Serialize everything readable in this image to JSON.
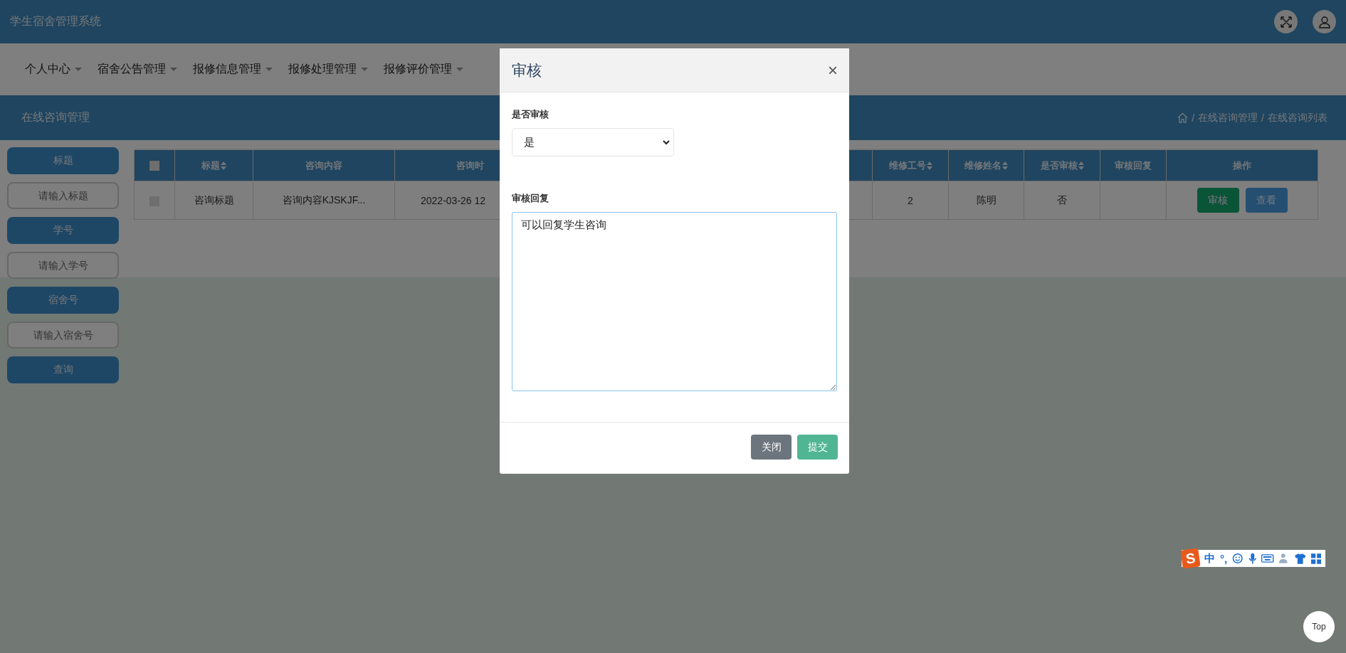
{
  "header": {
    "title": "学生宿舍管理系统"
  },
  "nav": [
    {
      "label": "个人中心"
    },
    {
      "label": "宿舍公告管理"
    },
    {
      "label": "报修信息管理"
    },
    {
      "label": "报修处理管理"
    },
    {
      "label": "报修评价管理"
    }
  ],
  "page_bar": {
    "title": "在线咨询管理",
    "separator": "/",
    "breadcrumb": [
      "在线咨询管理",
      "在线咨询列表"
    ]
  },
  "search": [
    {
      "kind": "label",
      "text": "标题"
    },
    {
      "kind": "field",
      "placeholder": "请输入标题"
    },
    {
      "kind": "label",
      "text": "学号"
    },
    {
      "kind": "field",
      "placeholder": "请输入学号"
    },
    {
      "kind": "label",
      "text": "宿舍号"
    },
    {
      "kind": "field",
      "placeholder": "请输入宿舍号"
    },
    {
      "kind": "button",
      "text": "查询"
    }
  ],
  "table": {
    "all_checked": false,
    "columns": [
      {
        "label": "标题",
        "sortable": true
      },
      {
        "label": "咨询内容",
        "sortable": false
      },
      {
        "label": "咨询时",
        "sortable": false
      },
      {
        "label": "维修工号",
        "sortable": true
      },
      {
        "label": "维修姓名",
        "sortable": true
      },
      {
        "label": "是否审核",
        "sortable": true
      },
      {
        "label": "审核回复",
        "sortable": false
      },
      {
        "label": "操作",
        "sortable": false
      }
    ],
    "rows": [
      {
        "checked": false,
        "cells": [
          "咨询标题",
          "咨询内容KJSKJF...",
          "2022-03-26 12",
          "2",
          "陈明",
          "否",
          null
        ],
        "actions": [
          {
            "label": "审核",
            "kind": "success"
          },
          {
            "label": "查看",
            "kind": "info"
          }
        ]
      }
    ]
  },
  "modal": {
    "title": "审核",
    "close": "×",
    "fields": [
      {
        "kind": "select",
        "label": "是否审核",
        "value": "是"
      },
      {
        "kind": "textarea",
        "label": "审核回复",
        "value": "可以回复学生咨询"
      }
    ],
    "buttons": [
      {
        "label": "关闭",
        "kind": "secondary"
      },
      {
        "label": "提交",
        "kind": "success"
      }
    ]
  },
  "ime_bar": {
    "logo": "S",
    "items": [
      "中",
      "°,"
    ]
  },
  "top_button": {
    "label": "Top"
  }
}
